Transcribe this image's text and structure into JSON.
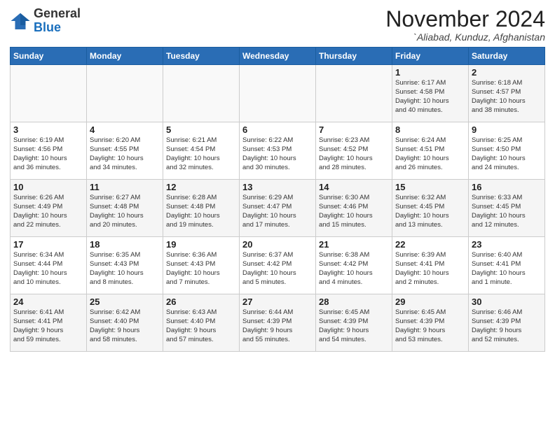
{
  "header": {
    "logo_general": "General",
    "logo_blue": "Blue",
    "month_title": "November 2024",
    "location": "`Aliabad, Kunduz, Afghanistan"
  },
  "weekdays": [
    "Sunday",
    "Monday",
    "Tuesday",
    "Wednesday",
    "Thursday",
    "Friday",
    "Saturday"
  ],
  "weeks": [
    [
      {
        "day": "",
        "info": ""
      },
      {
        "day": "",
        "info": ""
      },
      {
        "day": "",
        "info": ""
      },
      {
        "day": "",
        "info": ""
      },
      {
        "day": "",
        "info": ""
      },
      {
        "day": "1",
        "info": "Sunrise: 6:17 AM\nSunset: 4:58 PM\nDaylight: 10 hours\nand 40 minutes."
      },
      {
        "day": "2",
        "info": "Sunrise: 6:18 AM\nSunset: 4:57 PM\nDaylight: 10 hours\nand 38 minutes."
      }
    ],
    [
      {
        "day": "3",
        "info": "Sunrise: 6:19 AM\nSunset: 4:56 PM\nDaylight: 10 hours\nand 36 minutes."
      },
      {
        "day": "4",
        "info": "Sunrise: 6:20 AM\nSunset: 4:55 PM\nDaylight: 10 hours\nand 34 minutes."
      },
      {
        "day": "5",
        "info": "Sunrise: 6:21 AM\nSunset: 4:54 PM\nDaylight: 10 hours\nand 32 minutes."
      },
      {
        "day": "6",
        "info": "Sunrise: 6:22 AM\nSunset: 4:53 PM\nDaylight: 10 hours\nand 30 minutes."
      },
      {
        "day": "7",
        "info": "Sunrise: 6:23 AM\nSunset: 4:52 PM\nDaylight: 10 hours\nand 28 minutes."
      },
      {
        "day": "8",
        "info": "Sunrise: 6:24 AM\nSunset: 4:51 PM\nDaylight: 10 hours\nand 26 minutes."
      },
      {
        "day": "9",
        "info": "Sunrise: 6:25 AM\nSunset: 4:50 PM\nDaylight: 10 hours\nand 24 minutes."
      }
    ],
    [
      {
        "day": "10",
        "info": "Sunrise: 6:26 AM\nSunset: 4:49 PM\nDaylight: 10 hours\nand 22 minutes."
      },
      {
        "day": "11",
        "info": "Sunrise: 6:27 AM\nSunset: 4:48 PM\nDaylight: 10 hours\nand 20 minutes."
      },
      {
        "day": "12",
        "info": "Sunrise: 6:28 AM\nSunset: 4:48 PM\nDaylight: 10 hours\nand 19 minutes."
      },
      {
        "day": "13",
        "info": "Sunrise: 6:29 AM\nSunset: 4:47 PM\nDaylight: 10 hours\nand 17 minutes."
      },
      {
        "day": "14",
        "info": "Sunrise: 6:30 AM\nSunset: 4:46 PM\nDaylight: 10 hours\nand 15 minutes."
      },
      {
        "day": "15",
        "info": "Sunrise: 6:32 AM\nSunset: 4:45 PM\nDaylight: 10 hours\nand 13 minutes."
      },
      {
        "day": "16",
        "info": "Sunrise: 6:33 AM\nSunset: 4:45 PM\nDaylight: 10 hours\nand 12 minutes."
      }
    ],
    [
      {
        "day": "17",
        "info": "Sunrise: 6:34 AM\nSunset: 4:44 PM\nDaylight: 10 hours\nand 10 minutes."
      },
      {
        "day": "18",
        "info": "Sunrise: 6:35 AM\nSunset: 4:43 PM\nDaylight: 10 hours\nand 8 minutes."
      },
      {
        "day": "19",
        "info": "Sunrise: 6:36 AM\nSunset: 4:43 PM\nDaylight: 10 hours\nand 7 minutes."
      },
      {
        "day": "20",
        "info": "Sunrise: 6:37 AM\nSunset: 4:42 PM\nDaylight: 10 hours\nand 5 minutes."
      },
      {
        "day": "21",
        "info": "Sunrise: 6:38 AM\nSunset: 4:42 PM\nDaylight: 10 hours\nand 4 minutes."
      },
      {
        "day": "22",
        "info": "Sunrise: 6:39 AM\nSunset: 4:41 PM\nDaylight: 10 hours\nand 2 minutes."
      },
      {
        "day": "23",
        "info": "Sunrise: 6:40 AM\nSunset: 4:41 PM\nDaylight: 10 hours\nand 1 minute."
      }
    ],
    [
      {
        "day": "24",
        "info": "Sunrise: 6:41 AM\nSunset: 4:41 PM\nDaylight: 9 hours\nand 59 minutes."
      },
      {
        "day": "25",
        "info": "Sunrise: 6:42 AM\nSunset: 4:40 PM\nDaylight: 9 hours\nand 58 minutes."
      },
      {
        "day": "26",
        "info": "Sunrise: 6:43 AM\nSunset: 4:40 PM\nDaylight: 9 hours\nand 57 minutes."
      },
      {
        "day": "27",
        "info": "Sunrise: 6:44 AM\nSunset: 4:39 PM\nDaylight: 9 hours\nand 55 minutes."
      },
      {
        "day": "28",
        "info": "Sunrise: 6:45 AM\nSunset: 4:39 PM\nDaylight: 9 hours\nand 54 minutes."
      },
      {
        "day": "29",
        "info": "Sunrise: 6:45 AM\nSunset: 4:39 PM\nDaylight: 9 hours\nand 53 minutes."
      },
      {
        "day": "30",
        "info": "Sunrise: 6:46 AM\nSunset: 4:39 PM\nDaylight: 9 hours\nand 52 minutes."
      }
    ]
  ]
}
